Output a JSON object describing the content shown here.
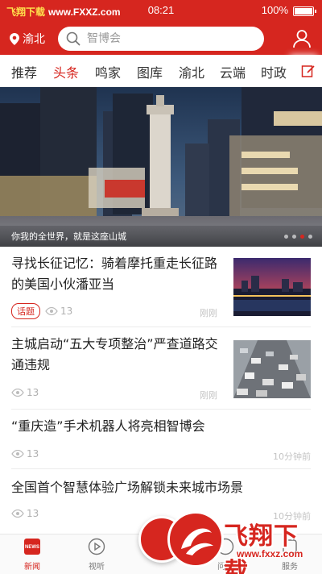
{
  "status_bar": {
    "watermark_cn": "飞翔下载",
    "watermark_url": "www.FXXZ.com",
    "time": "08:21",
    "battery": "100%"
  },
  "header": {
    "location": "渝北",
    "search_placeholder": "智博会",
    "icons": [
      "location-pin-icon",
      "search-icon",
      "user-icon"
    ]
  },
  "tabs": [
    "推荐",
    "头条",
    "鸣家",
    "图库",
    "渝北",
    "云端",
    "时政"
  ],
  "active_tab": "头条",
  "banner": {
    "caption": "你我的全世界，就是这座山城",
    "slides": 4,
    "active_slide": 3
  },
  "news": [
    {
      "title": "寻找长征记忆：骑着摩托重走长征路的美国小伙潘亚当",
      "tag": "话题",
      "views": "13",
      "time": "刚刚"
    },
    {
      "title": "主城启动“五大专项整治”严查道路交通违规",
      "views": "13",
      "time": "刚刚"
    },
    {
      "title": "“重庆造”手术机器人将亮相智博会",
      "views": "13",
      "time": "10分钟前"
    },
    {
      "title": "全国首个智慧体验广场解锁未来城市场景",
      "views": "13",
      "time": "10分钟前"
    }
  ],
  "bottom_nav": {
    "items": [
      {
        "label": "新闻",
        "icon": "news-icon"
      },
      {
        "label": "视听",
        "icon": "play-icon"
      },
      {
        "label": "问政",
        "icon": "question-icon"
      },
      {
        "label": "服务",
        "icon": "service-icon"
      }
    ],
    "active": "新闻"
  },
  "brand_watermark": {
    "cn": "飞翔下载",
    "en": "www.fxxz.com"
  },
  "colors": {
    "brand_red": "#d6261f",
    "text": "#222222",
    "muted": "#b0b0b0"
  }
}
